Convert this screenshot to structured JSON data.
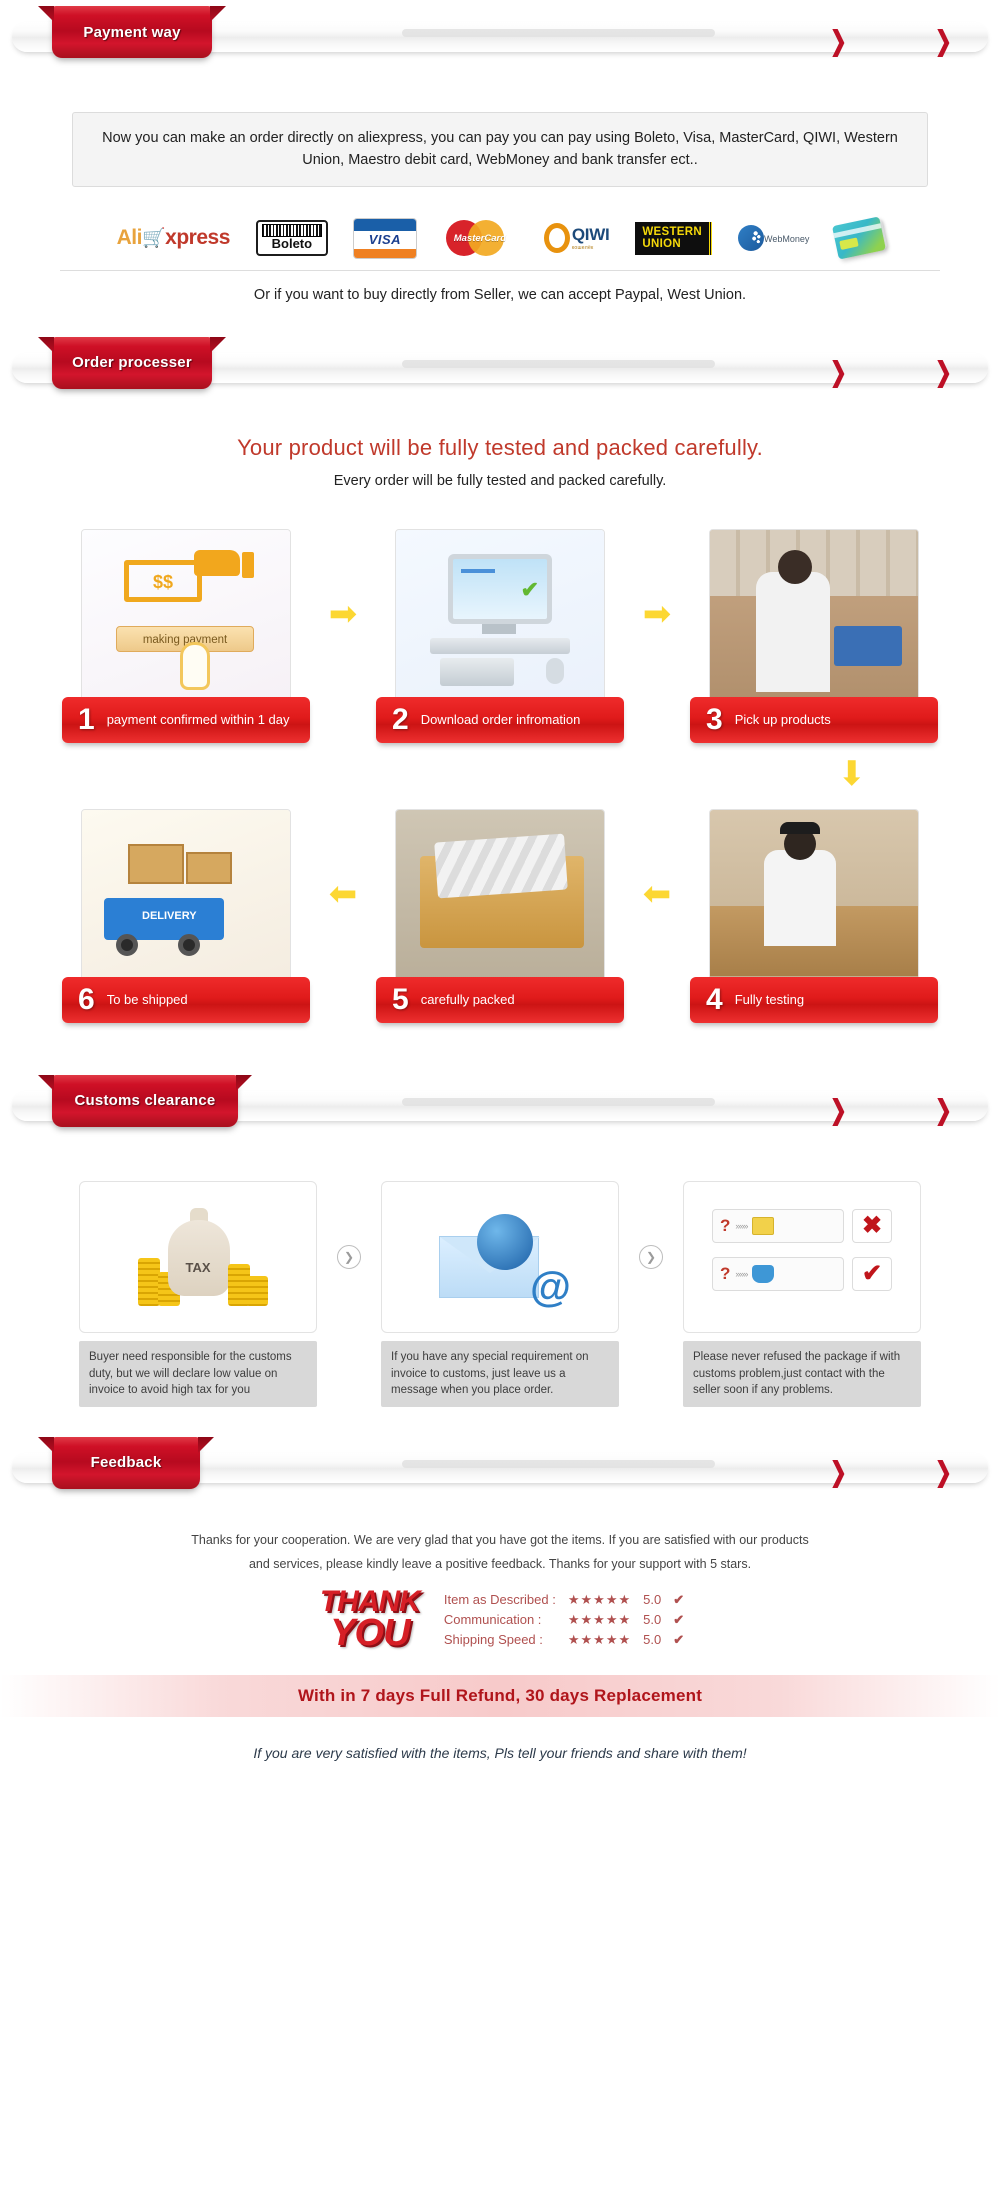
{
  "sections": {
    "payment": {
      "ribbon": "Payment way"
    },
    "order": {
      "ribbon": "Order processer"
    },
    "customs": {
      "ribbon": "Customs clearance"
    },
    "feedback": {
      "ribbon": "Feedback"
    }
  },
  "payment": {
    "note": "Now you can make an order directly on aliexpress, you can pay you can pay using Boleto, Visa, MasterCard, QIWI, Western Union, Maestro debit card, WebMoney and bank transfer ect..",
    "footer": "Or if you want to buy directly from Seller, we can accept Paypal, West Union.",
    "logos": [
      {
        "name": "aliexpress-logo",
        "ali": "Ali",
        "cart": "🛒",
        "xp": "xpress"
      },
      {
        "name": "boleto-logo",
        "label": "Boleto"
      },
      {
        "name": "visa-logo",
        "label": "VISA"
      },
      {
        "name": "mastercard-logo",
        "label": "MasterCard"
      },
      {
        "name": "qiwi-logo",
        "label": "QIWI",
        "sub": "кошелёк"
      },
      {
        "name": "western-union-logo",
        "line1": "WESTERN",
        "line2": "UNION"
      },
      {
        "name": "webmoney-logo",
        "label": "WebMoney"
      },
      {
        "name": "maestro-card-logo",
        "label": ""
      }
    ]
  },
  "order_process": {
    "title": "Your product will be fully tested and packed carefully.",
    "subtitle": "Every order will be fully tested and packed carefully.",
    "steps": [
      {
        "num": "1",
        "text": "payment confirmed within 1 day",
        "art": "making-payment",
        "caption_art": "making payment"
      },
      {
        "num": "2",
        "text": "Download order infromation",
        "art": "computer-order"
      },
      {
        "num": "3",
        "text": "Pick up products",
        "art": "warehouse-pick"
      },
      {
        "num": "4",
        "text": "Fully testing",
        "art": "testing-bench"
      },
      {
        "num": "5",
        "text": "carefully packed",
        "art": "packed-carton"
      },
      {
        "num": "6",
        "text": "To be shipped",
        "art": "delivery-truck",
        "truck_label": "DELIVERY"
      }
    ],
    "arrows": {
      "right": "➡",
      "left": "⬅",
      "down": "⬇"
    }
  },
  "customs": {
    "cards": [
      {
        "icon": "tax-money-bag",
        "bag_label": "TAX",
        "note": "Buyer need responsible for the customs duty, but we will declare low value on invoice to avoid high tax for you"
      },
      {
        "icon": "globe-email",
        "note": "If you have any special requirement on invoice to customs, just leave us a message when you place order."
      },
      {
        "icon": "refuse-package",
        "note": "Please never refused the package if with customs problem,just contact with the seller soon if any problems.",
        "rows": [
          {
            "q": "?",
            "dots": "»»»",
            "item": "package",
            "mark": "✖"
          },
          {
            "q": "?",
            "dots": "»»»",
            "item": "telephone",
            "mark": "✔"
          }
        ]
      }
    ],
    "separator_icon": "❯"
  },
  "feedback": {
    "paragraph": "Thanks for your cooperation. We are very glad that you have got the items. If you are satisfied with our products and services, please kindly leave a positive feedback. Thanks for your support with 5 stars.",
    "thankyou_line1": "THANK",
    "thankyou_line2": "YOU",
    "stars": "★★★★★",
    "check": "✔",
    "ratings": [
      {
        "label": "Item as Described :",
        "score": "5.0"
      },
      {
        "label": "Communication :",
        "score": "5.0"
      },
      {
        "label": "Shipping Speed :",
        "score": "5.0"
      }
    ],
    "refund_banner": "With  in  7 days Full Refund, 30 days Replacement",
    "share_note": "If you are very satisfied with the items, Pls tell your friends and share with them!"
  },
  "colors": {
    "ribbon_red": "#c0121f",
    "caption_red": "#e01b1b",
    "title_red": "#c0392b",
    "arrow_yellow": "#fcd733",
    "star_gold": "#f2c200"
  }
}
